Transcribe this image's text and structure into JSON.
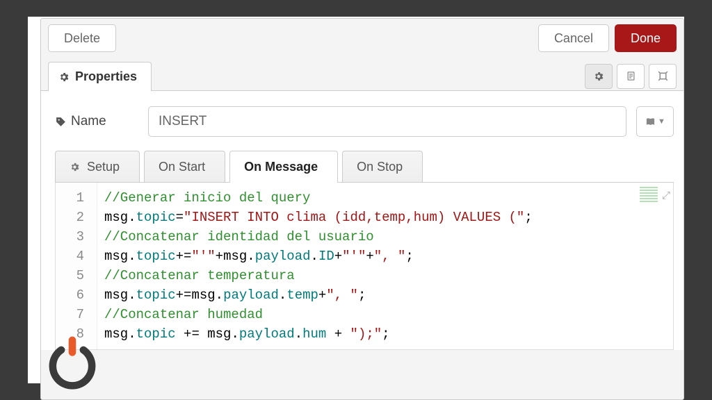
{
  "header": {
    "delete_label": "Delete",
    "cancel_label": "Cancel",
    "done_label": "Done"
  },
  "properties": {
    "tab_label": "Properties"
  },
  "name_field": {
    "label": "Name",
    "value": "INSERT"
  },
  "fn_tabs": {
    "setup": "Setup",
    "on_start": "On Start",
    "on_message": "On Message",
    "on_stop": "On Stop"
  },
  "editor": {
    "line_numbers": [
      "1",
      "2",
      "3",
      "4",
      "5",
      "6",
      "7",
      "8"
    ],
    "lines": [
      {
        "type": "comment",
        "text": "//Generar inicio del query"
      },
      {
        "type": "code",
        "tokens": [
          {
            "t": "msg",
            "c": "key"
          },
          {
            "t": ".",
            "c": "op"
          },
          {
            "t": "topic",
            "c": "prop"
          },
          {
            "t": "=",
            "c": "op"
          },
          {
            "t": "\"INSERT INTO clima (idd,temp,hum) VALUES (\"",
            "c": "string"
          },
          {
            "t": ";",
            "c": "op"
          }
        ]
      },
      {
        "type": "comment",
        "text": "//Concatenar identidad del usuario"
      },
      {
        "type": "code",
        "tokens": [
          {
            "t": "msg",
            "c": "key"
          },
          {
            "t": ".",
            "c": "op"
          },
          {
            "t": "topic",
            "c": "prop"
          },
          {
            "t": "+=",
            "c": "op"
          },
          {
            "t": "\"'\"",
            "c": "string"
          },
          {
            "t": "+",
            "c": "op"
          },
          {
            "t": "msg",
            "c": "key"
          },
          {
            "t": ".",
            "c": "op"
          },
          {
            "t": "payload",
            "c": "prop"
          },
          {
            "t": ".",
            "c": "op"
          },
          {
            "t": "ID",
            "c": "prop"
          },
          {
            "t": "+",
            "c": "op"
          },
          {
            "t": "\"'\"",
            "c": "string"
          },
          {
            "t": "+",
            "c": "op"
          },
          {
            "t": "\", \"",
            "c": "string"
          },
          {
            "t": ";",
            "c": "op"
          }
        ]
      },
      {
        "type": "comment",
        "text": "//Concatenar temperatura"
      },
      {
        "type": "code",
        "tokens": [
          {
            "t": "msg",
            "c": "key"
          },
          {
            "t": ".",
            "c": "op"
          },
          {
            "t": "topic",
            "c": "prop"
          },
          {
            "t": "+=",
            "c": "op"
          },
          {
            "t": "msg",
            "c": "key"
          },
          {
            "t": ".",
            "c": "op"
          },
          {
            "t": "payload",
            "c": "prop"
          },
          {
            "t": ".",
            "c": "op"
          },
          {
            "t": "temp",
            "c": "prop"
          },
          {
            "t": "+",
            "c": "op"
          },
          {
            "t": "\", \"",
            "c": "string"
          },
          {
            "t": ";",
            "c": "op"
          }
        ]
      },
      {
        "type": "comment",
        "text": "//Concatenar humedad"
      },
      {
        "type": "code",
        "tokens": [
          {
            "t": "msg",
            "c": "key"
          },
          {
            "t": ".",
            "c": "op"
          },
          {
            "t": "topic",
            "c": "prop"
          },
          {
            "t": " += ",
            "c": "op"
          },
          {
            "t": "msg",
            "c": "key"
          },
          {
            "t": ".",
            "c": "op"
          },
          {
            "t": "payload",
            "c": "prop"
          },
          {
            "t": ".",
            "c": "op"
          },
          {
            "t": "hum",
            "c": "prop"
          },
          {
            "t": " + ",
            "c": "op"
          },
          {
            "t": "\");\"",
            "c": "string"
          },
          {
            "t": ";",
            "c": "op"
          }
        ]
      }
    ]
  }
}
